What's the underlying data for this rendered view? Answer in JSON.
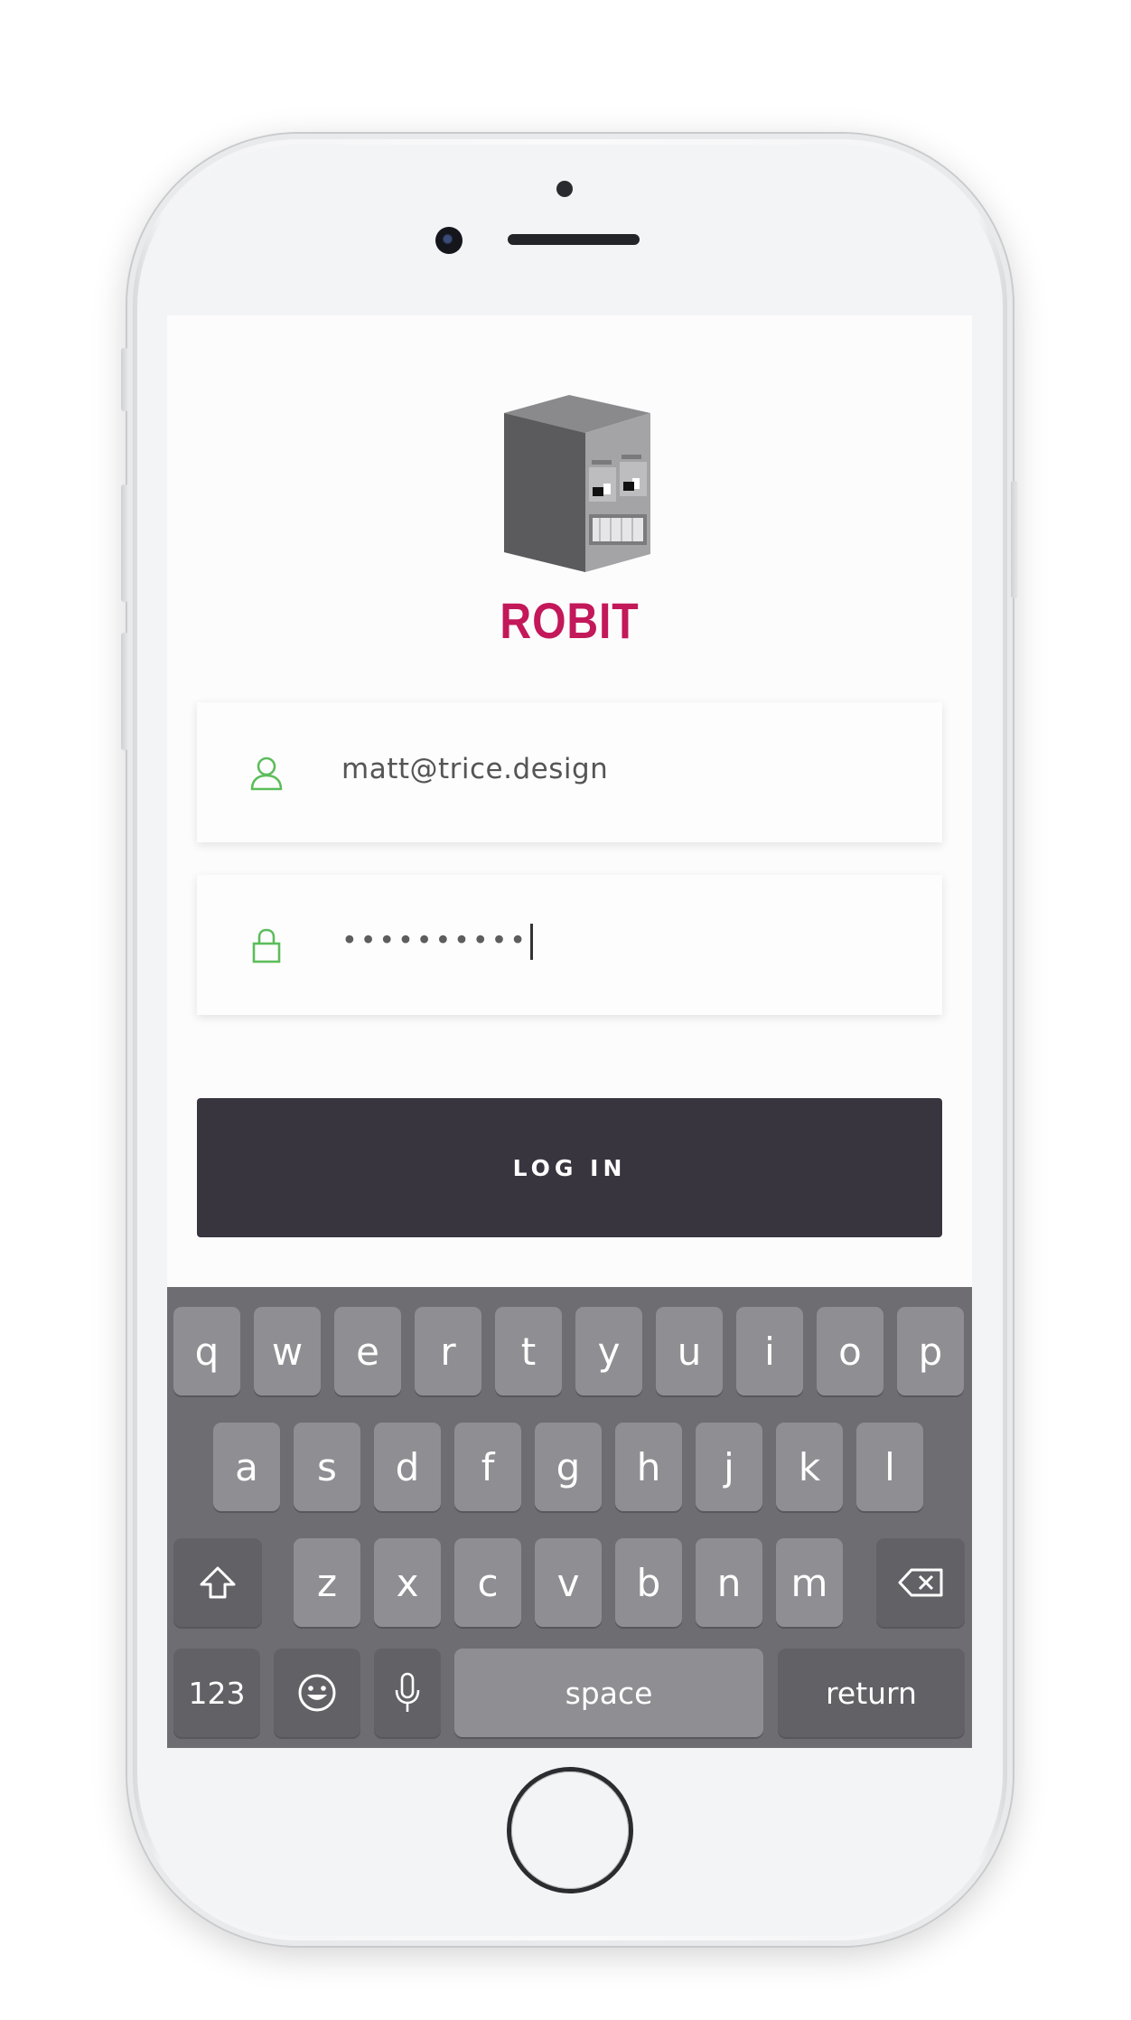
{
  "app": {
    "brand_name": "ROBIT",
    "accent_color": "#c3185a",
    "icon_color": "#5cbd5a"
  },
  "login_form": {
    "email": {
      "icon": "user-icon",
      "value": "matt@trice.design"
    },
    "password": {
      "icon": "lock-icon",
      "masked_value": "••••••••••"
    },
    "submit_label": "LOG IN",
    "submit_color": "#38353f"
  },
  "keyboard": {
    "row1": [
      "q",
      "w",
      "e",
      "r",
      "t",
      "y",
      "u",
      "i",
      "o",
      "p"
    ],
    "row2": [
      "a",
      "s",
      "d",
      "f",
      "g",
      "h",
      "j",
      "k",
      "l"
    ],
    "row3": [
      "z",
      "x",
      "c",
      "v",
      "b",
      "n",
      "m"
    ],
    "shift_icon": "shift-icon",
    "delete_icon": "delete-icon",
    "numbers_label": "123",
    "emoji_icon": "emoji-icon",
    "mic_icon": "microphone-icon",
    "space_label": "space",
    "return_label": "return"
  }
}
